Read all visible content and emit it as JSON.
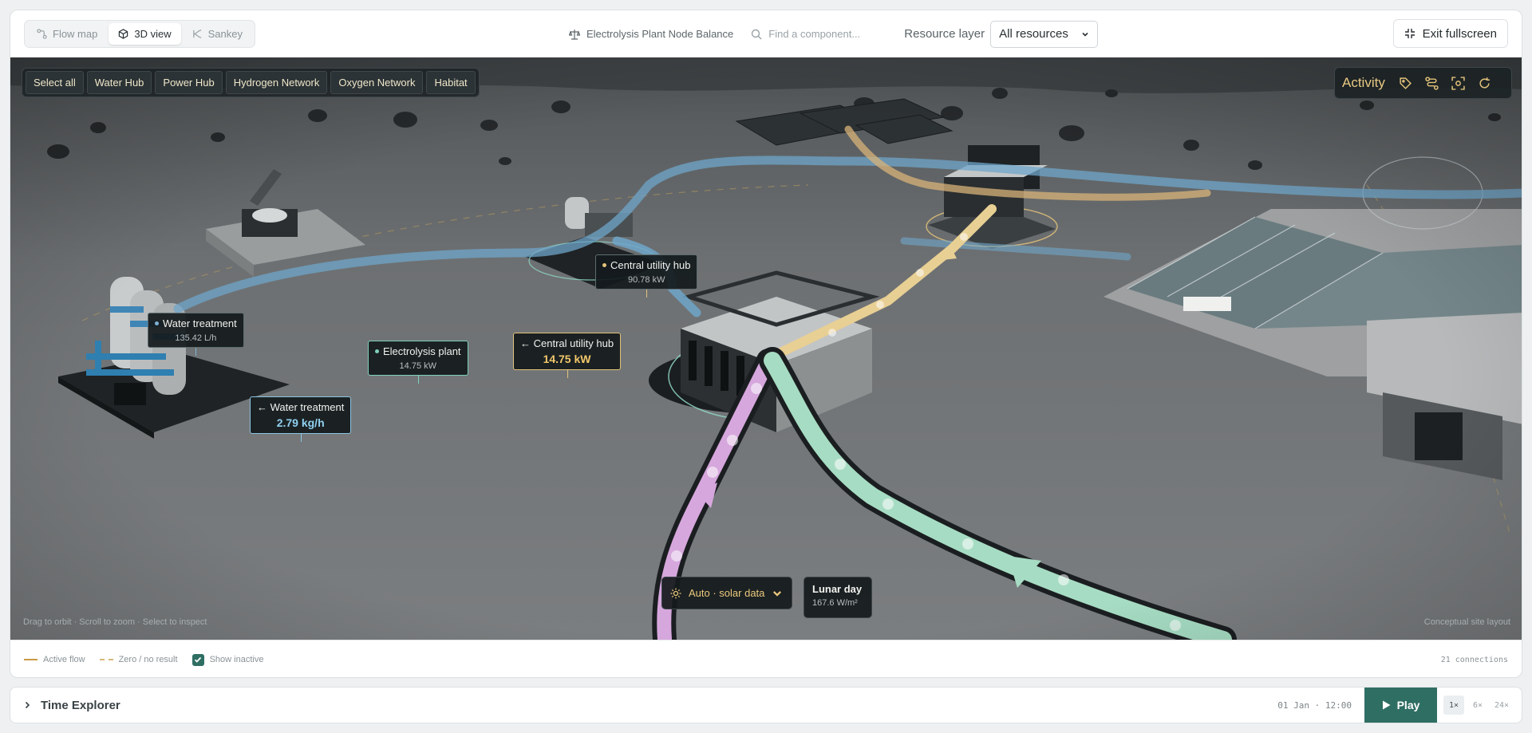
{
  "view_switch": {
    "items": [
      {
        "label": "Flow map"
      },
      {
        "label": "3D view"
      },
      {
        "label": "Sankey"
      }
    ]
  },
  "topbar": {
    "balance_label": "Electrolysis Plant Node Balance",
    "search_placeholder": "Find a component...",
    "resource_layer_label": "Resource layer",
    "resource_layer_value": "All resources",
    "exit_label": "Exit fullscreen"
  },
  "groups": {
    "items": [
      {
        "label": "Select all"
      },
      {
        "label": "Water Hub"
      },
      {
        "label": "Power Hub"
      },
      {
        "label": "Hydrogen Network"
      },
      {
        "label": "Oxygen Network"
      },
      {
        "label": "Habitat"
      }
    ]
  },
  "activity": {
    "label": "Activity",
    "icons": [
      "tag-icon",
      "route-icon",
      "focus-icon",
      "reset-icon"
    ]
  },
  "tags": {
    "utility_hub_top": {
      "title": "Central utility hub",
      "value": "90.78 kW"
    },
    "water_treatment": {
      "title": "Water treatment",
      "value": "135.42 L/h"
    },
    "electrolysis": {
      "title": "Electrolysis plant",
      "value": "14.75 kW"
    },
    "utility_hub_flow": {
      "title": "← Central utility hub",
      "value": "14.75 kW"
    },
    "water_treatment_flow": {
      "title": "← Water treatment",
      "value": "2.79 kg/h"
    }
  },
  "solar": {
    "mode": "Auto · solar data",
    "period": "Lunar day",
    "irradiance": "167.6 W/m²"
  },
  "hints": {
    "left": "Drag to orbit · Scroll to zoom · Select to inspect",
    "right": "Conceptual site layout"
  },
  "legend": {
    "active": "Active flow",
    "zero": "Zero / no result",
    "show_inactive": "Show inactive",
    "connections": "21 connections"
  },
  "timeline": {
    "title": "Time Explorer",
    "date": "01 Jan · 12:00",
    "play": "Play",
    "speeds": [
      "1×",
      "6×",
      "24×"
    ],
    "active_speed": "1×"
  },
  "colors": {
    "accent": "#2f6e63",
    "gold": "#e3c27a",
    "water": "#7fb2d4",
    "oxygen": "#a6dcc3",
    "hydrogen": "#d6a7dd"
  }
}
